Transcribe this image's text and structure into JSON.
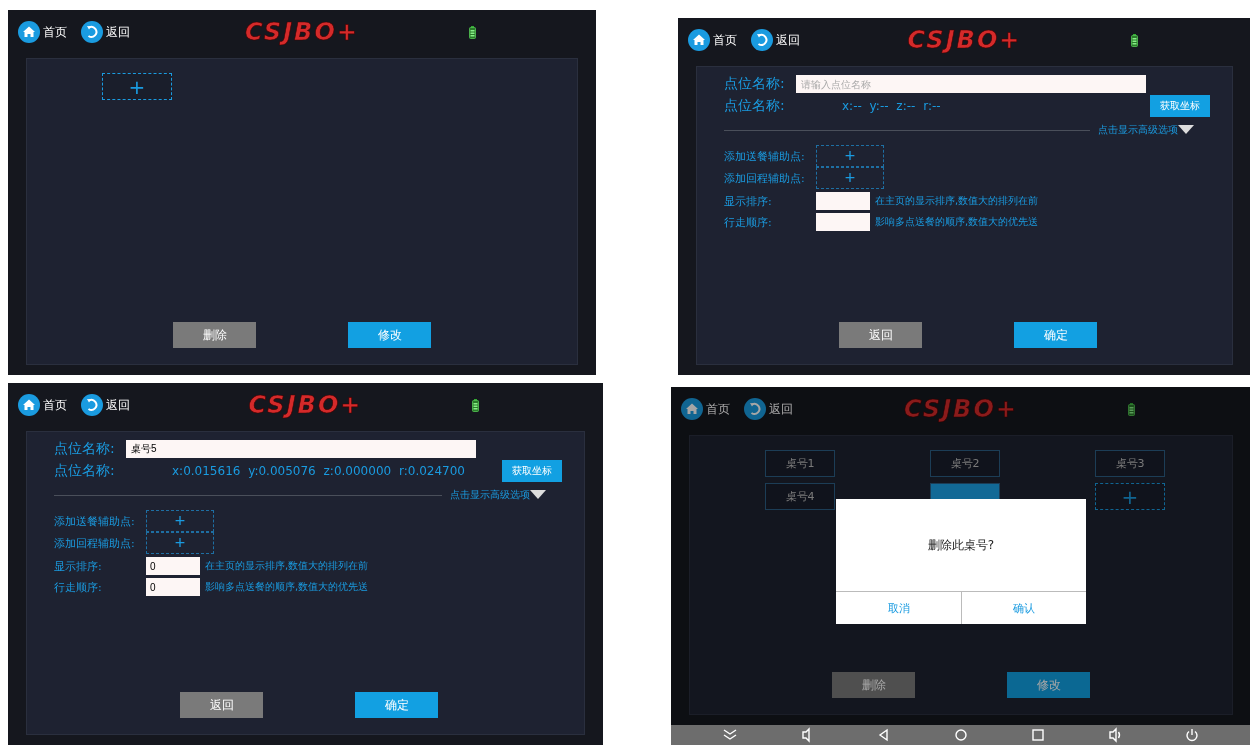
{
  "panels": [
    {
      "kind": "tables",
      "header": {
        "home": "首页",
        "back": "返回",
        "logo": "CSJBO+"
      },
      "add": "+",
      "buttons": [
        {
          "label": "删除",
          "kind": "secondary"
        },
        {
          "label": "修改",
          "kind": "primary"
        }
      ]
    },
    {
      "kind": "form",
      "header": {
        "home": "首页",
        "back": "返回",
        "logo": "CSJBO+"
      },
      "name_label": "点位名称:",
      "name_field": {
        "placeholder": "请输入点位名称"
      },
      "coord_label": "点位名称:",
      "coords": "x:-- y:-- z:-- r:--",
      "get_button": "获取坐标",
      "advanced": "点击显示高级选项",
      "helpers": [
        {
          "label": "添加送餐辅助点:",
          "add": "+"
        },
        {
          "label": "添加回程辅助点:",
          "add": "+"
        }
      ],
      "orders": [
        {
          "label": "显示排序:",
          "hint": "在主页的显示排序,数值大的排列在前"
        },
        {
          "label": "行走顺序:",
          "hint": "影响多点送餐的顺序,数值大的优先送"
        }
      ],
      "buttons": [
        {
          "label": "返回",
          "kind": "secondary"
        },
        {
          "label": "确定",
          "kind": "primary"
        }
      ]
    },
    {
      "kind": "form",
      "header": {
        "home": "首页",
        "back": "返回",
        "logo": "CSJBO+"
      },
      "name_label": "点位名称:",
      "name_field": {
        "value": "桌号5"
      },
      "coord_label": "点位名称:",
      "coords": "x:0.015616 y:0.005076 z:0.000000 r:0.024700",
      "get_button": "获取坐标",
      "advanced": "点击显示高级选项",
      "helpers": [
        {
          "label": "添加送餐辅助点:",
          "add": "+"
        },
        {
          "label": "添加回程辅助点:",
          "add": "+"
        }
      ],
      "orders": [
        {
          "label": "显示排序:",
          "value": "0",
          "hint": "在主页的显示排序,数值大的排列在前"
        },
        {
          "label": "行走顺序:",
          "value": "0",
          "hint": "影响多点送餐的顺序,数值大的优先送"
        }
      ],
      "buttons": [
        {
          "label": "返回",
          "kind": "secondary"
        },
        {
          "label": "确定",
          "kind": "primary"
        }
      ]
    },
    {
      "kind": "tables",
      "header": {
        "home": "首页",
        "back": "返回",
        "logo": "CSJBO+"
      },
      "tiles": [
        {
          "label": "桌号1",
          "selected": false
        },
        {
          "label": "桌号2",
          "selected": false
        },
        {
          "label": "桌号3",
          "selected": false
        },
        {
          "label": "桌号4",
          "selected": false
        },
        {
          "selected": true
        }
      ],
      "add": "+",
      "buttons": [
        {
          "label": "删除",
          "kind": "secondary"
        },
        {
          "label": "修改",
          "kind": "primary"
        }
      ],
      "dialog": {
        "message": "删除此桌号?",
        "buttons": [
          "取消",
          "确认"
        ]
      },
      "nav_bar": true
    }
  ]
}
